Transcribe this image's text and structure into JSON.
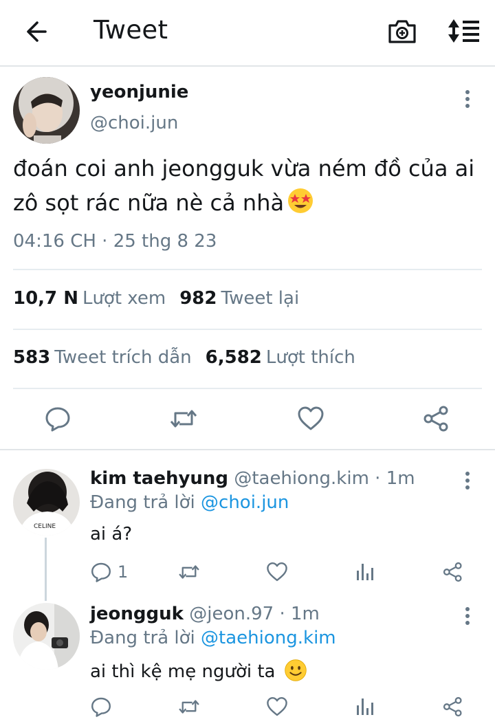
{
  "header": {
    "title": "Tweet"
  },
  "tweet": {
    "display_name": "yeonjunie",
    "handle": "@choi.jun",
    "text": "đoán coi anh jeongguk vừa ném đồ của ai zô sọt rác nữa nè cả nhà",
    "timestamp": "04:16 CH · 25 thg 8 23",
    "stats": {
      "views_count": "10,7 N",
      "views_label": "Lượt xem",
      "retweets_count": "982",
      "retweets_label": "Tweet lại",
      "quotes_count": "583",
      "quotes_label": "Tweet trích dẫn",
      "likes_count": "6,582",
      "likes_label": "Lượt thích"
    }
  },
  "replies": [
    {
      "display_name": "kim taehyung",
      "meta": "@taehiong.kim · 1m",
      "replying_prefix": "Đang trả lời",
      "replying_to": "@choi.jun",
      "text": "ai á?",
      "reply_count": "1"
    },
    {
      "display_name": "jeongguk",
      "meta": "@jeon.97 · 1m",
      "replying_prefix": "Đang trả lời",
      "replying_to": "@taehiong.kim",
      "text": "ai thì kệ mẹ người ta",
      "reply_count": ""
    }
  ],
  "colors": {
    "accent": "#1b95e0",
    "icon": "#657786",
    "text": "#14171a"
  },
  "icons": [
    "back-arrow-icon",
    "camera-icon",
    "sort-icon",
    "more-vertical-icon",
    "reply-icon",
    "retweet-icon",
    "like-icon",
    "share-icon",
    "analytics-icon",
    "star-struck-emoji",
    "smile-emoji"
  ]
}
